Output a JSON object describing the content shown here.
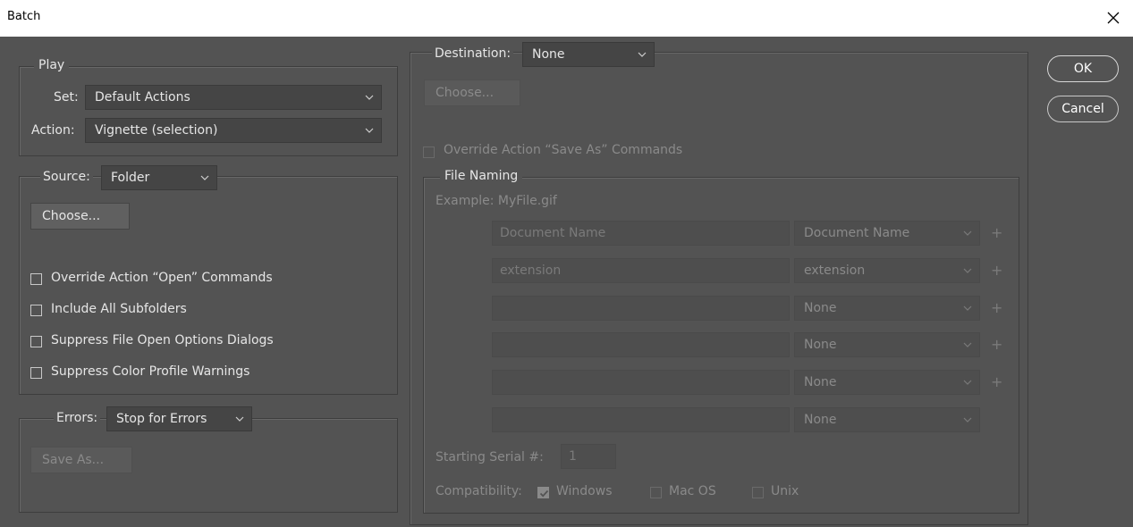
{
  "window": {
    "title": "Batch"
  },
  "play": {
    "legend": "Play",
    "set_label": "Set:",
    "set_value": "Default Actions",
    "action_label": "Action:",
    "action_value": "Vignette (selection)"
  },
  "source": {
    "label": "Source:",
    "value": "Folder",
    "choose_label": "Choose...",
    "checkboxes": [
      {
        "label": "Override Action “Open” Commands",
        "checked": false
      },
      {
        "label": "Include All Subfolders",
        "checked": false
      },
      {
        "label": "Suppress File Open Options Dialogs",
        "checked": false
      },
      {
        "label": "Suppress Color Profile Warnings",
        "checked": false
      }
    ]
  },
  "errors": {
    "label": "Errors:",
    "value": "Stop for Errors",
    "save_as_label": "Save As..."
  },
  "destination": {
    "label": "Destination:",
    "value": "None",
    "choose_label": "Choose...",
    "override_label": "Override Action “Save As” Commands",
    "override_checked": false
  },
  "file_naming": {
    "legend": "File Naming",
    "example": "Example: MyFile.gif",
    "rows": [
      {
        "field": "Document Name",
        "select": "Document Name",
        "plus": "+"
      },
      {
        "field": "extension",
        "select": "extension",
        "plus": "+"
      },
      {
        "field": "",
        "select": "None",
        "plus": "+"
      },
      {
        "field": "",
        "select": "None",
        "plus": "+"
      },
      {
        "field": "",
        "select": "None",
        "plus": "+"
      },
      {
        "field": "",
        "select": "None",
        "plus": ""
      }
    ],
    "serial_label": "Starting Serial #:",
    "serial_value": "1",
    "compat_label": "Compatibility:",
    "compat": [
      {
        "label": "Windows",
        "checked": true
      },
      {
        "label": "Mac OS",
        "checked": false
      },
      {
        "label": "Unix",
        "checked": false
      }
    ]
  },
  "buttons": {
    "ok": "OK",
    "cancel": "Cancel"
  }
}
